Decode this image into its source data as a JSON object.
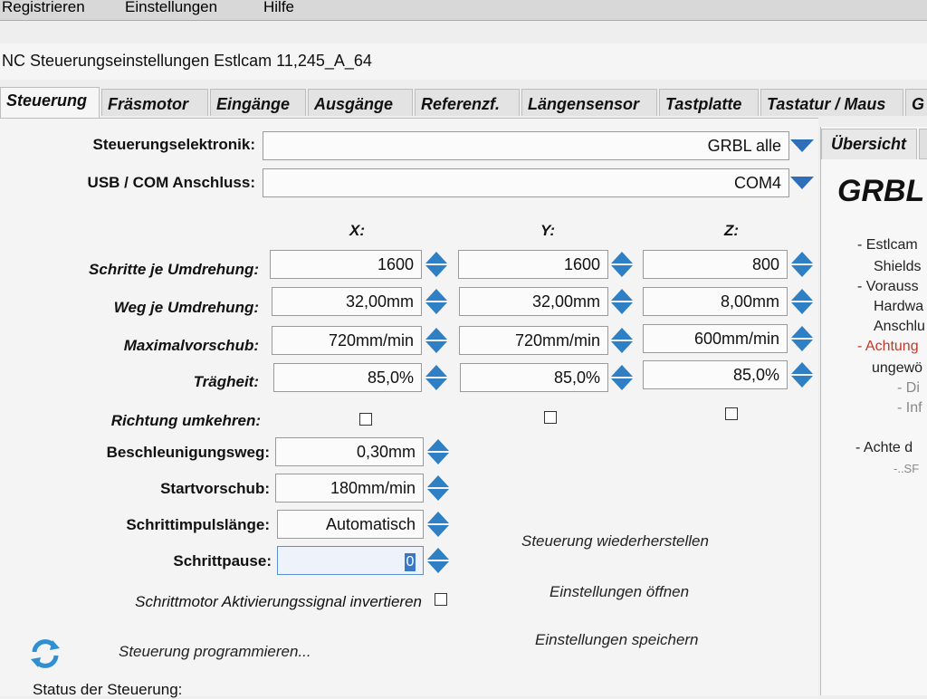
{
  "menu": {
    "items": [
      "Registrieren",
      "Einstellungen",
      "Hilfe"
    ]
  },
  "window": {
    "title": "NC Steuerungseinstellungen Estlcam 11,245_A_64"
  },
  "tabs": [
    "Steuerung",
    "Fräsmotor",
    "Eingänge",
    "Ausgänge",
    "Referenzf.",
    "Längensensor",
    "Tastplatte",
    "Tastatur / Maus",
    "G"
  ],
  "controller": {
    "label": "Steuerungselektronik:",
    "value": "GRBL alle",
    "port_label": "USB / COM Anschluss:",
    "port_value": "COM4"
  },
  "axes": {
    "headers": [
      "X:",
      "Y:",
      "Z:"
    ],
    "rows": [
      {
        "label": "Schritte je Umdrehung:",
        "values": [
          "1600",
          "1600",
          "800"
        ]
      },
      {
        "label": "Weg je Umdrehung:",
        "values": [
          "32,00mm",
          "32,00mm",
          "8,00mm"
        ]
      },
      {
        "label": "Maximalvorschub:",
        "values": [
          "720mm/min",
          "720mm/min",
          "600mm/min"
        ]
      },
      {
        "label": "Trägheit:",
        "values": [
          "85,0%",
          "85,0%",
          "85,0%"
        ]
      }
    ],
    "reverse_label": "Richtung umkehren:"
  },
  "settings": {
    "accel_label": "Beschleunigungsweg:",
    "accel_value": "0,30mm",
    "start_label": "Startvorschub:",
    "start_value": "180mm/min",
    "pulse_label": "Schrittimpulslänge:",
    "pulse_value": "Automatisch",
    "pause_label": "Schrittpause:",
    "pause_value": "0",
    "invert_label": "Schrittmotor Aktivierungssignal invertieren"
  },
  "actions": {
    "restore": "Steuerung wiederherstellen",
    "open": "Einstellungen öffnen",
    "save": "Einstellungen speichern",
    "program": "Steuerung programmieren...",
    "status": "Status der Steuerung:"
  },
  "info": {
    "tab": "Übersicht",
    "title": "GRBL",
    "lines": [
      "- Estlcam",
      "Shields",
      "- Vorauss",
      "Hardwa",
      "Anschlu",
      "- Achtung",
      "ungewö",
      "- Di",
      "- Inf",
      "- Achte d",
      "-..SF"
    ]
  },
  "colors": {
    "accent": "#2f7fc4",
    "warning": "#c0392b"
  }
}
